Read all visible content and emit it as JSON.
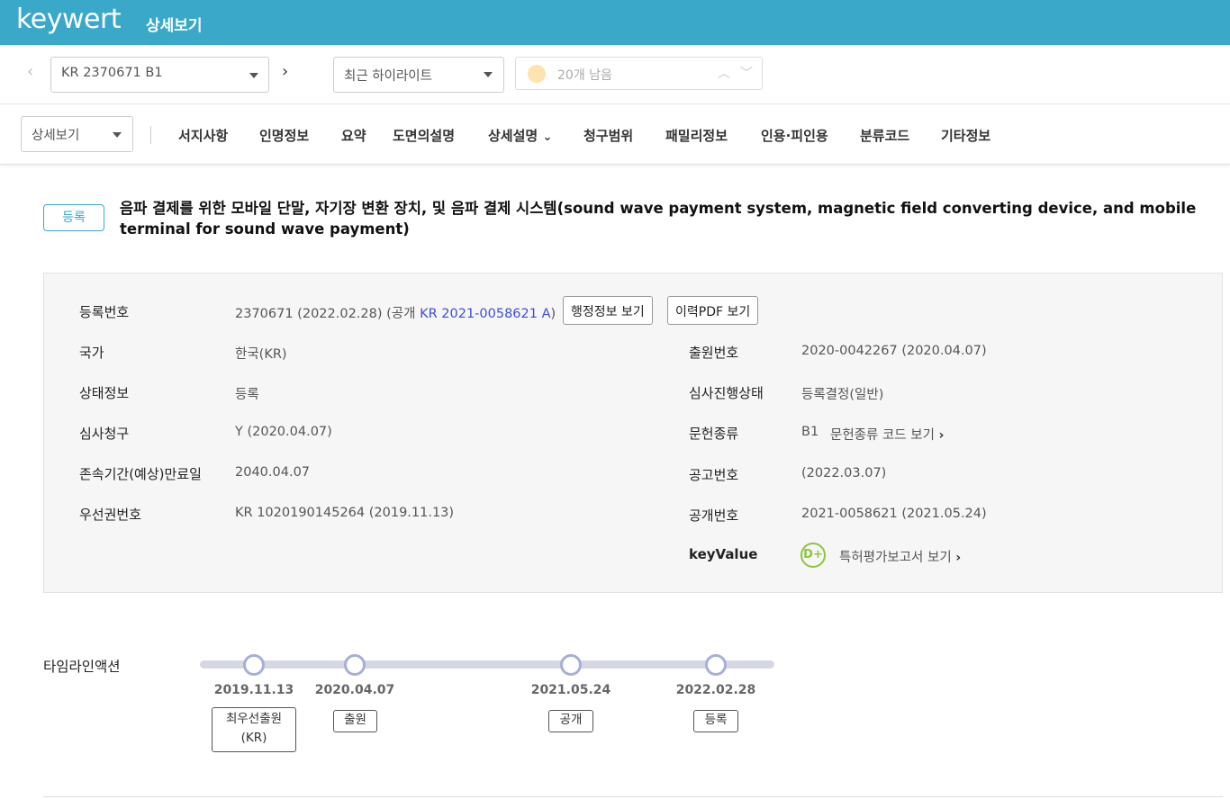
{
  "app": {
    "logo": "keywert",
    "page_title": "상세보기"
  },
  "nav": {
    "prev_icon": "‹",
    "next_icon": "›",
    "patent_select": "KR 2370671 B1",
    "highlight_select": "최근 하이라이트",
    "highlight_status": "20개 남음",
    "up_icon": "︿",
    "down_icon": "﹀"
  },
  "tabs": {
    "view_select": "상세보기",
    "items": [
      "서지사항",
      "인명정보",
      "요약",
      "도면의설명",
      "상세설명",
      "청구범위",
      "패밀리정보",
      "인용·피인용",
      "분류코드",
      "기타정보"
    ],
    "dropdown_icon": "⌄"
  },
  "header": {
    "status_badge": "등록",
    "title": "음파 결제를 위한 모바일 단말, 자기장 변환 장치, 및 음파 결제 시스템(sound wave payment system, magnetic field converting device, and mobile terminal for sound wave payment)"
  },
  "info": {
    "reg_label": "등록번호",
    "reg_value": "2370671 (2022.02.28) (공개 ",
    "reg_link": "KR 2021-0058621 A",
    "reg_value_end": ")",
    "admin_button": "행정정보 보기",
    "pdf_button": "이력PDF 보기",
    "country_label": "국가",
    "country_value": "한국(KR)",
    "app_no_label": "출원번호",
    "app_no_value": "2020-0042267 (2020.04.07)",
    "state_label": "상태정보",
    "state_value": "등록",
    "exam_progress_label": "심사진행상태",
    "exam_progress_value": "등록결정(일반)",
    "exam_request_label": "심사청구",
    "exam_request_value": "Y (2020.04.07)",
    "doc_type_label": "문헌종류",
    "doc_type_value": "B1",
    "doc_type_link": "문헌종류 코드 보기",
    "expiry_label": "존속기간(예상)만료일",
    "expiry_value": "2040.04.07",
    "notice_label": "공고번호",
    "notice_value": "(2022.03.07)",
    "priority_label": "우선권번호",
    "priority_value": "KR 1020190145264 (2019.11.13)",
    "pub_label": "공개번호",
    "pub_value": "2021-0058621 (2021.05.24)",
    "keyvalue_label": "keyValue",
    "keyvalue_grade": "D+",
    "keyvalue_link": "특허평가보고서 보기",
    "chevron_icon": "›"
  },
  "timeline": {
    "label": "타임라인액션",
    "events": [
      {
        "date": "2019.11.13",
        "tag_line1": "최우선출원",
        "tag_line2": "(KR)"
      },
      {
        "date": "2020.04.07",
        "tag_line1": "출원"
      },
      {
        "date": "2021.05.24",
        "tag_line1": "공개"
      },
      {
        "date": "2022.02.28",
        "tag_line1": "등록"
      }
    ]
  },
  "colors": {
    "brand": "#3aa8c9",
    "link": "#3b4fd8",
    "keyvalue": "#8cc63f",
    "timeline_node": "#a5afd8"
  }
}
